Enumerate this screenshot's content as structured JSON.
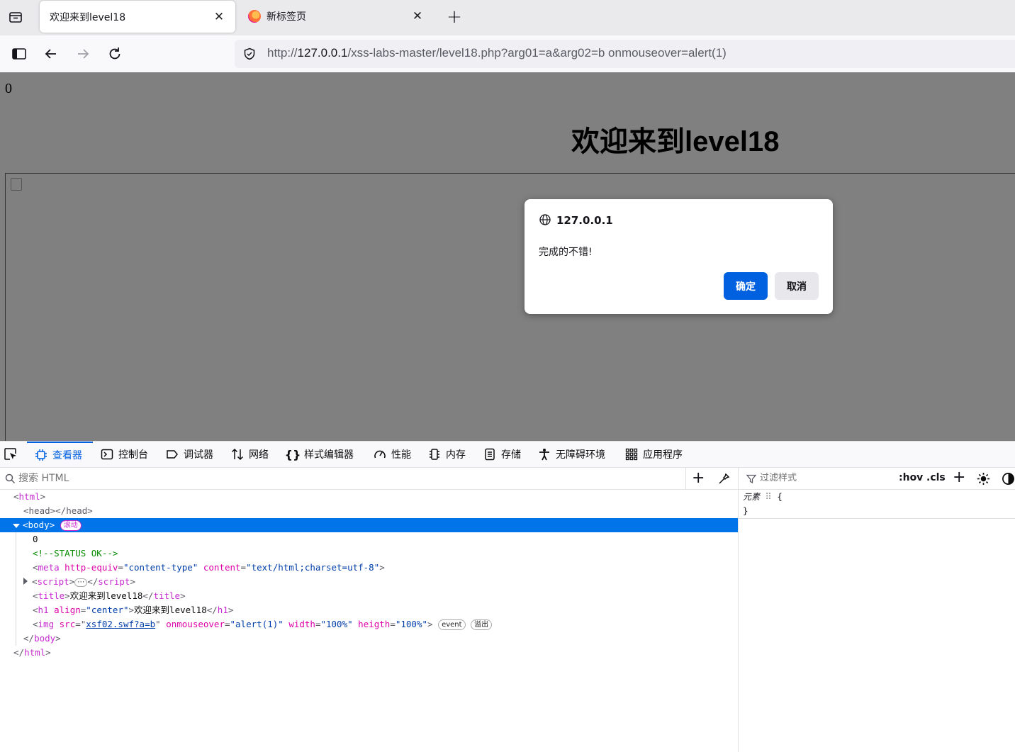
{
  "tabs": [
    {
      "title": "欢迎来到level18",
      "close": "✕"
    },
    {
      "title": "新标签页",
      "close": "✕"
    }
  ],
  "new_tab": "+",
  "url": {
    "scheme": "http://",
    "host": "127.0.0.1",
    "path": "/xss-labs-master/level18.php?arg01=a&arg02=b onmouseover=alert(1)"
  },
  "page": {
    "zero": "0",
    "heading": "欢迎来到level18"
  },
  "dialog": {
    "origin": "127.0.0.1",
    "message": "完成的不错!",
    "ok": "确定",
    "cancel": "取消"
  },
  "devtools": {
    "tabs": [
      "查看器",
      "控制台",
      "调试器",
      "网络",
      "样式编辑器",
      "性能",
      "内存",
      "存储",
      "无障碍环境",
      "应用程序"
    ],
    "search_placeholder": "搜索 HTML",
    "filter_placeholder": "过滤样式",
    "hov": ":hov",
    "cls": ".cls",
    "badge_scroll": "滚动",
    "badge_event": "event",
    "badge_overflow": "溢出",
    "ellipsis": "⋯",
    "element_rule": "元素",
    "tree": {
      "zero": "0",
      "comment": "<!--STATUS OK-->",
      "meta_http_equiv": "\"content-type\"",
      "meta_content": "\"text/html;charset=utf-8\"",
      "title_text": "欢迎来到level18",
      "h1_align": "\"center\"",
      "h1_text": "欢迎来到level18",
      "img_src": "xsf02.swf?a=b",
      "img_onmouseover": "\"alert(1)\"",
      "img_width": "\"100%\"",
      "img_heigth": "\"100%\""
    }
  }
}
